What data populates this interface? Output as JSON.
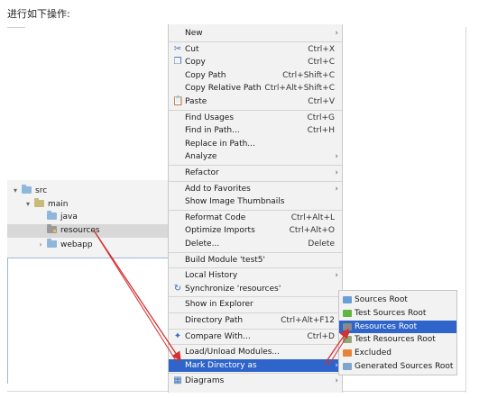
{
  "instruction": "进行如下操作:",
  "project_tree": [
    {
      "name": "src",
      "toggle": "▾",
      "indent": 0,
      "selected": false,
      "folder": "src"
    },
    {
      "name": "main",
      "toggle": "▾",
      "indent": 1,
      "selected": false,
      "folder": "plain"
    },
    {
      "name": "java",
      "toggle": "",
      "indent": 2,
      "selected": false,
      "folder": "src"
    },
    {
      "name": "resources",
      "toggle": "",
      "indent": 2,
      "selected": true,
      "folder": "res"
    },
    {
      "name": "webapp",
      "toggle": "›",
      "indent": 2,
      "selected": false,
      "folder": "src"
    }
  ],
  "context_menu": {
    "items": [
      {
        "label": "New",
        "shortcut": "",
        "submenu": true,
        "icon": ""
      },
      {
        "separator": true
      },
      {
        "label": "Cut",
        "shortcut": "Ctrl+X",
        "icon": "scissors-icon",
        "glyph": "✂"
      },
      {
        "label": "Copy",
        "shortcut": "Ctrl+C",
        "icon": "copy-icon",
        "glyph": "❐"
      },
      {
        "label": "Copy Path",
        "shortcut": "Ctrl+Shift+C",
        "icon": ""
      },
      {
        "label": "Copy Relative Path",
        "shortcut": "Ctrl+Alt+Shift+C",
        "icon": ""
      },
      {
        "label": "Paste",
        "shortcut": "Ctrl+V",
        "icon": "paste-icon",
        "glyph": "📋"
      },
      {
        "separator": true
      },
      {
        "label": "Find Usages",
        "shortcut": "Ctrl+G",
        "icon": ""
      },
      {
        "label": "Find in Path...",
        "shortcut": "Ctrl+H",
        "icon": ""
      },
      {
        "label": "Replace in Path...",
        "shortcut": "",
        "icon": ""
      },
      {
        "label": "Analyze",
        "shortcut": "",
        "submenu": true,
        "icon": ""
      },
      {
        "separator": true
      },
      {
        "label": "Refactor",
        "shortcut": "",
        "submenu": true,
        "icon": ""
      },
      {
        "separator": true
      },
      {
        "label": "Add to Favorites",
        "shortcut": "",
        "submenu": true,
        "icon": ""
      },
      {
        "label": "Show Image Thumbnails",
        "shortcut": "",
        "icon": ""
      },
      {
        "separator": true
      },
      {
        "label": "Reformat Code",
        "shortcut": "Ctrl+Alt+L",
        "icon": ""
      },
      {
        "label": "Optimize Imports",
        "shortcut": "Ctrl+Alt+O",
        "icon": ""
      },
      {
        "label": "Delete...",
        "shortcut": "Delete",
        "icon": ""
      },
      {
        "separator": true
      },
      {
        "label": "Build Module 'test5'",
        "shortcut": "",
        "icon": ""
      },
      {
        "separator": true
      },
      {
        "label": "Local History",
        "shortcut": "",
        "submenu": true,
        "icon": ""
      },
      {
        "label": "Synchronize 'resources'",
        "shortcut": "",
        "icon": "sync-icon",
        "glyph": "↻"
      },
      {
        "separator": true
      },
      {
        "label": "Show in Explorer",
        "shortcut": "",
        "icon": ""
      },
      {
        "separator": true
      },
      {
        "label": "Directory Path",
        "shortcut": "Ctrl+Alt+F12",
        "icon": ""
      },
      {
        "separator": true
      },
      {
        "label": "Compare With...",
        "shortcut": "Ctrl+D",
        "icon": "compare-icon",
        "glyph": "✦"
      },
      {
        "separator": true
      },
      {
        "label": "Load/Unload Modules...",
        "shortcut": "",
        "icon": ""
      },
      {
        "label": "Mark Directory as",
        "shortcut": "",
        "submenu": true,
        "highlight": true,
        "icon": ""
      },
      {
        "separator": true
      },
      {
        "label": "Diagrams",
        "shortcut": "",
        "submenu": true,
        "icon": "diagram-icon",
        "glyph": "▦"
      }
    ]
  },
  "mark_directory_submenu": [
    {
      "label": "Sources Root",
      "color": "#6a9fd4"
    },
    {
      "label": "Test Sources Root",
      "color": "#62b543"
    },
    {
      "label": "Resources Root",
      "color": "#8a8a8a",
      "highlight": true
    },
    {
      "label": "Test Resources Root",
      "color": "#8fa87a"
    },
    {
      "label": "Excluded",
      "color": "#e8843a"
    },
    {
      "label": "Generated Sources Root",
      "color": "#7fa6cf"
    }
  ],
  "colors": {
    "highlight": "#2f65ca",
    "annotation_arrow": "#d43030"
  }
}
